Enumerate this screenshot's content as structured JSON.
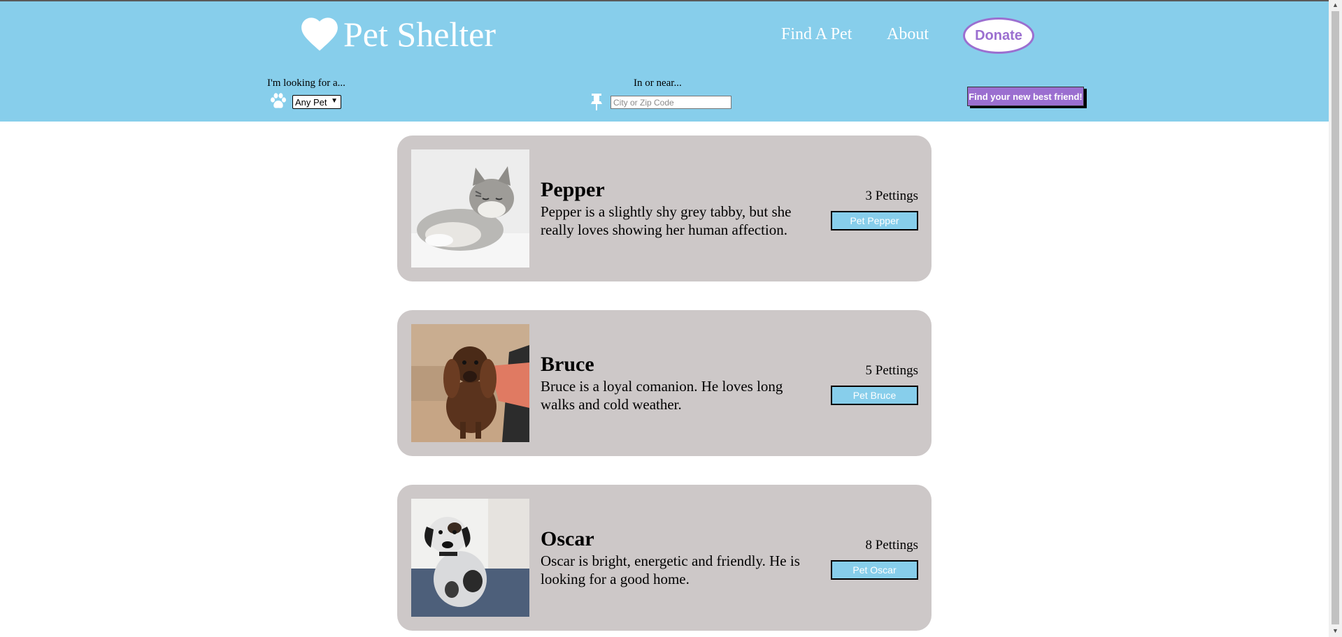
{
  "header": {
    "logo_text": "Pet Shelter",
    "nav": {
      "find": "Find A Pet",
      "about": "About",
      "donate": "Donate"
    },
    "search": {
      "type_label": "I'm looking for a...",
      "type_value": "Any Pet",
      "location_label": "In or near...",
      "location_placeholder": "City or Zip Code",
      "submit_label": "Find your new best friend!"
    }
  },
  "pets": [
    {
      "name": "Pepper",
      "description": "Pepper is a slightly shy grey tabby, but she really loves showing her human affection.",
      "count": "3 Pettings",
      "button": "Pet Pepper"
    },
    {
      "name": "Bruce",
      "description": "Bruce is a loyal comanion. He loves long walks and cold weather.",
      "count": "5 Pettings",
      "button": "Pet Bruce"
    },
    {
      "name": "Oscar",
      "description": "Oscar is bright, energetic and friendly. He is looking for a good home.",
      "count": "8 Pettings",
      "button": "Pet Oscar"
    }
  ],
  "icons": {
    "logo": "heart-icon",
    "pet_type": "paw-icon",
    "location": "pushpin-icon"
  },
  "colors": {
    "header": "#87ceeb",
    "accent": "#9b6fd0",
    "card": "#cdc8c8"
  }
}
